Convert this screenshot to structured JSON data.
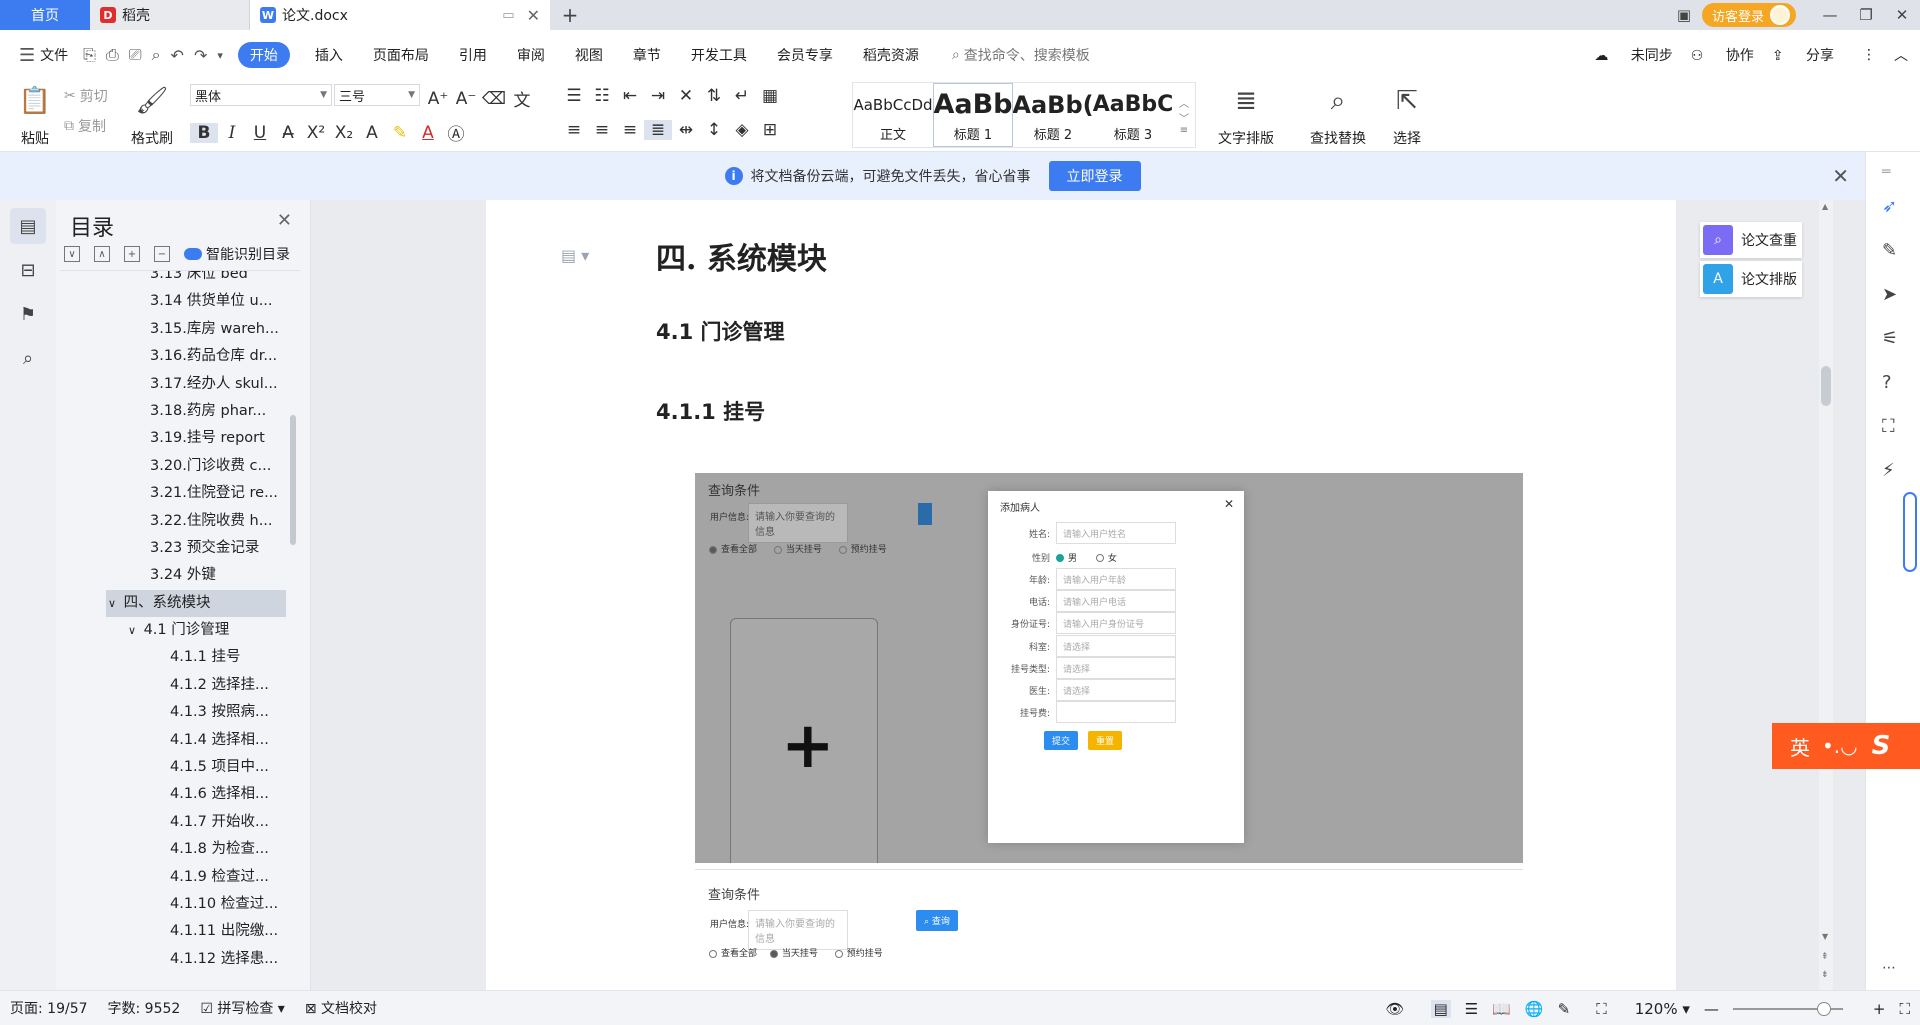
{
  "tabs": {
    "home": "首页",
    "daoke": "稻壳",
    "doc": "论文.docx"
  },
  "window": {
    "guest_login": "访客登录"
  },
  "menu": {
    "file": "文件",
    "items": [
      "开始",
      "插入",
      "页面布局",
      "引用",
      "审阅",
      "视图",
      "章节",
      "开发工具",
      "会员专享",
      "稻壳资源"
    ],
    "search_placeholder": "查找命令、搜索模板",
    "unsynced": "未同步",
    "collab": "协作",
    "share": "分享"
  },
  "ribbon": {
    "paste": "粘贴",
    "cut": "剪切",
    "copy": "复制",
    "format_painter": "格式刷",
    "font_name": "黑体",
    "font_size": "三号",
    "styles": [
      {
        "preview": "AaBbCcDd",
        "label": "正文"
      },
      {
        "preview": "AaBb",
        "label": "标题 1"
      },
      {
        "preview": "AaBb(",
        "label": "标题 2"
      },
      {
        "preview": "AaBbC",
        "label": "标题 3"
      }
    ],
    "text_layout": "文字排版",
    "find_replace": "查找替换",
    "select": "选择"
  },
  "notice": {
    "text": "将文档备份云端，可避免文件丢失，省心省事",
    "button": "立即登录"
  },
  "toc": {
    "title": "目录",
    "smart": "智能识别目录",
    "items": [
      {
        "label": "3.13 床位 bed",
        "level": "lv2"
      },
      {
        "label": "3.14 供货单位 u...",
        "level": "lv2"
      },
      {
        "label": "3.15.库房 wareh...",
        "level": "lv2"
      },
      {
        "label": "3.16.药品仓库 dr...",
        "level": "lv2"
      },
      {
        "label": "3.17.经办人 skul...",
        "level": "lv2"
      },
      {
        "label": "3.18.药房 phar...",
        "level": "lv2"
      },
      {
        "label": "3.19.挂号 report",
        "level": "lv2"
      },
      {
        "label": "3.20.门诊收费 c...",
        "level": "lv2"
      },
      {
        "label": "3.21.住院登记 re...",
        "level": "lv2"
      },
      {
        "label": "3.22.住院收费 h...",
        "level": "lv2"
      },
      {
        "label": "3.23 预交金记录",
        "level": "lv2"
      },
      {
        "label": "3.24 外键",
        "level": "lv2"
      },
      {
        "label": "四、系统模块",
        "level": "hl"
      },
      {
        "label": "4.1 门诊管理",
        "level": "lvx"
      },
      {
        "label": "4.1.1 挂号",
        "level": "lv3"
      },
      {
        "label": "4.1.2 选择挂...",
        "level": "lv3"
      },
      {
        "label": "4.1.3 按照病...",
        "level": "lv3"
      },
      {
        "label": "4.1.4 选择相...",
        "level": "lv3"
      },
      {
        "label": "4.1.5 项目中...",
        "level": "lv3"
      },
      {
        "label": "4.1.6 选择相...",
        "level": "lv3"
      },
      {
        "label": "4.1.7 开始收...",
        "level": "lv3"
      },
      {
        "label": "4.1.8 为检查...",
        "level": "lv3"
      },
      {
        "label": "4.1.9 检查过...",
        "level": "lv3"
      },
      {
        "label": "4.1.10 检查过...",
        "level": "lv3"
      },
      {
        "label": "4.1.11 出院缴...",
        "level": "lv3"
      },
      {
        "label": "4.1.12 选择患...",
        "level": "lv3"
      }
    ]
  },
  "doc": {
    "h1": "四. 系统模块",
    "h2": "4.1 门诊管理",
    "h3": "4.1.1 挂号"
  },
  "screenshot": {
    "query_title": "查询条件",
    "user_info_label": "用户信息:",
    "user_info_placeholder": "请输入你要查询的信息",
    "radio_all": "查看全部",
    "radio_today": "当天挂号",
    "radio_appt": "预约挂号",
    "query_btn": "查询",
    "modal_title": "添加病人",
    "fields": [
      {
        "label": "姓名:",
        "placeholder": "请输入用户姓名"
      },
      {
        "label": "年龄:",
        "placeholder": "请输入用户年龄"
      },
      {
        "label": "电话:",
        "placeholder": "请输入用户电话"
      },
      {
        "label": "身份证号:",
        "placeholder": "请输入用户身份证号"
      },
      {
        "label": "科室:",
        "placeholder": "请选择"
      },
      {
        "label": "挂号类型:",
        "placeholder": "请选择"
      },
      {
        "label": "医生:",
        "placeholder": "请选择"
      },
      {
        "label": "挂号费:",
        "placeholder": ""
      }
    ],
    "gender_label": "性别",
    "male": "男",
    "female": "女",
    "submit": "提交",
    "reset": "重置"
  },
  "side_tools": {
    "check": "论文查重",
    "layout": "论文排版"
  },
  "ime": {
    "label": "英"
  },
  "status": {
    "page": "页面: 19/57",
    "words": "字数: 9552",
    "spell": "拼写检查",
    "proof": "文档校对",
    "zoom": "120%"
  },
  "colors": {
    "accent": "#3d7cf0",
    "guest": "#f5a623",
    "ime": "#ff5a1f",
    "teal": "#1aa39a"
  }
}
